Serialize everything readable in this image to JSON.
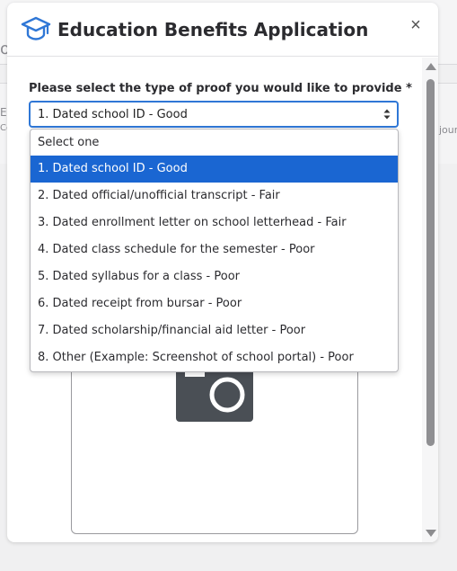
{
  "background": {
    "left_fragments": [
      "o",
      "Ec",
      "Co"
    ],
    "right_fragment": "jour"
  },
  "modal": {
    "title": "Education Benefits Application",
    "close_label": "×",
    "icon": "graduation-cap-icon"
  },
  "form": {
    "label": "Please select the type of proof you would like to provide *",
    "selected_value": "1. Dated school ID - Good",
    "options": [
      "Select one",
      "1. Dated school ID - Good",
      "2. Dated official/unofficial transcript - Fair",
      "3. Dated enrollment letter on school letterhead - Fair",
      "4. Dated class schedule for the semester - Poor",
      "5. Dated syllabus for a class - Poor",
      "6. Dated receipt from bursar - Poor",
      "7. Dated scholarship/financial aid letter - Poor",
      "8. Other (Example: Screenshot of school portal) - Poor"
    ],
    "selected_index": 1
  },
  "upload": {
    "icon": "camera-icon"
  },
  "colors": {
    "accent": "#1a66d2",
    "focus_border": "#2f77d6",
    "icon_blue": "#2f77d6",
    "camera": "#4a4f55"
  }
}
